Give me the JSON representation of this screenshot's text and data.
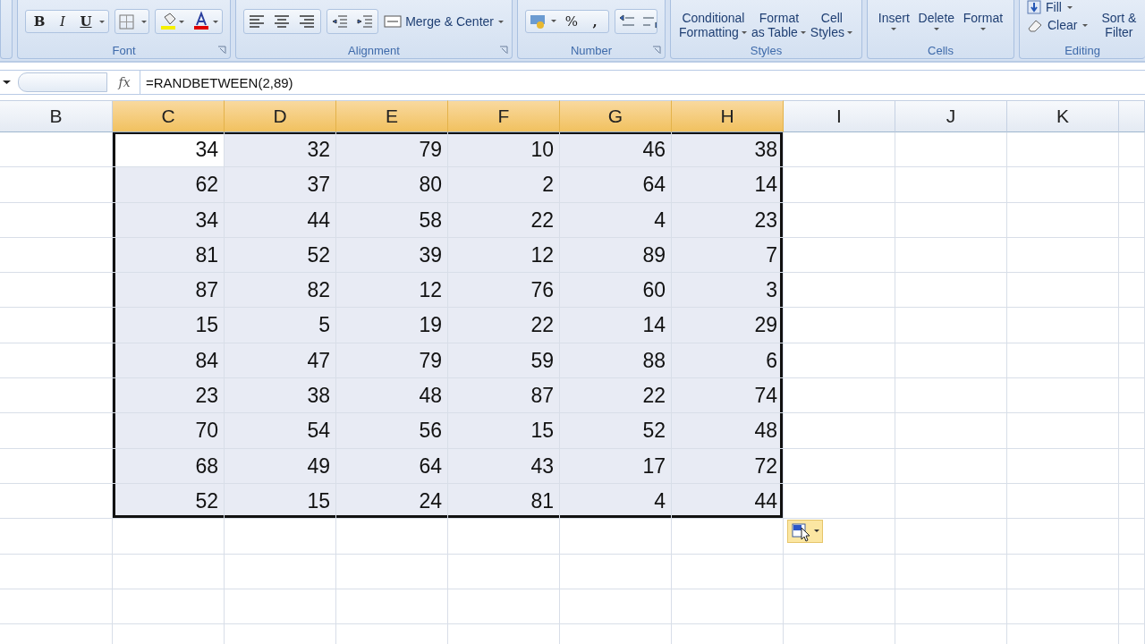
{
  "ribbon": {
    "font": {
      "label": "Font",
      "bold": "B",
      "italic": "I",
      "underline": "U"
    },
    "alignment": {
      "label": "Alignment",
      "merge": "Merge & Center"
    },
    "number": {
      "label": "Number",
      "percent": "%",
      "comma": ","
    },
    "styles": {
      "label": "Styles",
      "buttons": [
        {
          "line1": "Conditional",
          "line2": "Formatting"
        },
        {
          "line1": "Format",
          "line2": "as Table"
        },
        {
          "line1": "Cell",
          "line2": "Styles"
        }
      ]
    },
    "cells": {
      "label": "Cells",
      "buttons": [
        "Insert",
        "Delete",
        "Format"
      ]
    },
    "editing": {
      "label": "Editing",
      "fill": "Fill",
      "clear": "Clear",
      "sort": {
        "line1": "Sort &",
        "line2": "Filter"
      }
    }
  },
  "formula_bar": {
    "fx": "fx",
    "formula": "=RANDBETWEEN(2,89)"
  },
  "columns": [
    {
      "label": "B",
      "selected": false
    },
    {
      "label": "C",
      "selected": true
    },
    {
      "label": "D",
      "selected": true
    },
    {
      "label": "E",
      "selected": true
    },
    {
      "label": "F",
      "selected": true
    },
    {
      "label": "G",
      "selected": true
    },
    {
      "label": "H",
      "selected": true
    },
    {
      "label": "I",
      "selected": false
    },
    {
      "label": "J",
      "selected": false
    },
    {
      "label": "K",
      "selected": false
    }
  ],
  "rows": [
    {
      "cells": [
        {
          "value": "34",
          "active": true
        },
        {
          "value": "32",
          "active": false
        },
        {
          "value": "79",
          "active": false
        },
        {
          "value": "10",
          "active": false
        },
        {
          "value": "46",
          "active": false
        },
        {
          "value": "38",
          "active": false
        }
      ]
    },
    {
      "cells": [
        {
          "value": "62",
          "active": false
        },
        {
          "value": "37",
          "active": false
        },
        {
          "value": "80",
          "active": false
        },
        {
          "value": "2",
          "active": false
        },
        {
          "value": "64",
          "active": false
        },
        {
          "value": "14",
          "active": false
        }
      ]
    },
    {
      "cells": [
        {
          "value": "34",
          "active": false
        },
        {
          "value": "44",
          "active": false
        },
        {
          "value": "58",
          "active": false
        },
        {
          "value": "22",
          "active": false
        },
        {
          "value": "4",
          "active": false
        },
        {
          "value": "23",
          "active": false
        }
      ]
    },
    {
      "cells": [
        {
          "value": "81",
          "active": false
        },
        {
          "value": "52",
          "active": false
        },
        {
          "value": "39",
          "active": false
        },
        {
          "value": "12",
          "active": false
        },
        {
          "value": "89",
          "active": false
        },
        {
          "value": "7",
          "active": false
        }
      ]
    },
    {
      "cells": [
        {
          "value": "87",
          "active": false
        },
        {
          "value": "82",
          "active": false
        },
        {
          "value": "12",
          "active": false
        },
        {
          "value": "76",
          "active": false
        },
        {
          "value": "60",
          "active": false
        },
        {
          "value": "3",
          "active": false
        }
      ]
    },
    {
      "cells": [
        {
          "value": "15",
          "active": false
        },
        {
          "value": "5",
          "active": false
        },
        {
          "value": "19",
          "active": false
        },
        {
          "value": "22",
          "active": false
        },
        {
          "value": "14",
          "active": false
        },
        {
          "value": "29",
          "active": false
        }
      ]
    },
    {
      "cells": [
        {
          "value": "84",
          "active": false
        },
        {
          "value": "47",
          "active": false
        },
        {
          "value": "79",
          "active": false
        },
        {
          "value": "59",
          "active": false
        },
        {
          "value": "88",
          "active": false
        },
        {
          "value": "6",
          "active": false
        }
      ]
    },
    {
      "cells": [
        {
          "value": "23",
          "active": false
        },
        {
          "value": "38",
          "active": false
        },
        {
          "value": "48",
          "active": false
        },
        {
          "value": "87",
          "active": false
        },
        {
          "value": "22",
          "active": false
        },
        {
          "value": "74",
          "active": false
        }
      ]
    },
    {
      "cells": [
        {
          "value": "70",
          "active": false
        },
        {
          "value": "54",
          "active": false
        },
        {
          "value": "56",
          "active": false
        },
        {
          "value": "15",
          "active": false
        },
        {
          "value": "52",
          "active": false
        },
        {
          "value": "48",
          "active": false
        }
      ]
    },
    {
      "cells": [
        {
          "value": "68",
          "active": false
        },
        {
          "value": "49",
          "active": false
        },
        {
          "value": "64",
          "active": false
        },
        {
          "value": "43",
          "active": false
        },
        {
          "value": "17",
          "active": false
        },
        {
          "value": "72",
          "active": false
        }
      ]
    },
    {
      "cells": [
        {
          "value": "52",
          "active": false
        },
        {
          "value": "15",
          "active": false
        },
        {
          "value": "24",
          "active": false
        },
        {
          "value": "81",
          "active": false
        },
        {
          "value": "4",
          "active": false
        },
        {
          "value": "44",
          "active": false
        }
      ]
    }
  ]
}
